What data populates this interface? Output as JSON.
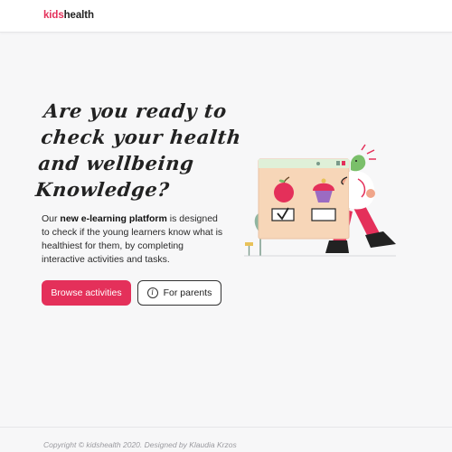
{
  "header": {
    "logo_part1": "kids",
    "logo_part2": "health"
  },
  "hero": {
    "headline_lines": [
      "Are you ready to",
      "check your health",
      "and wellbeing",
      "Knowledge?"
    ],
    "intro_prefix": "Our ",
    "intro_bold": "new e-learning platform",
    "intro_suffix": " is designed to check if the young learners know what is healthiest for them, by completing interactive activities and tasks."
  },
  "actions": {
    "primary_label": "Browse activities",
    "secondary_label": "For parents",
    "secondary_icon": "info-icon"
  },
  "footer": {
    "copyright": "Copyright © kidshealth 2020. Designed by Klaudia Krzos"
  },
  "colors": {
    "brand": "#e4305a",
    "background": "#f7f7f8",
    "text": "#222222"
  }
}
